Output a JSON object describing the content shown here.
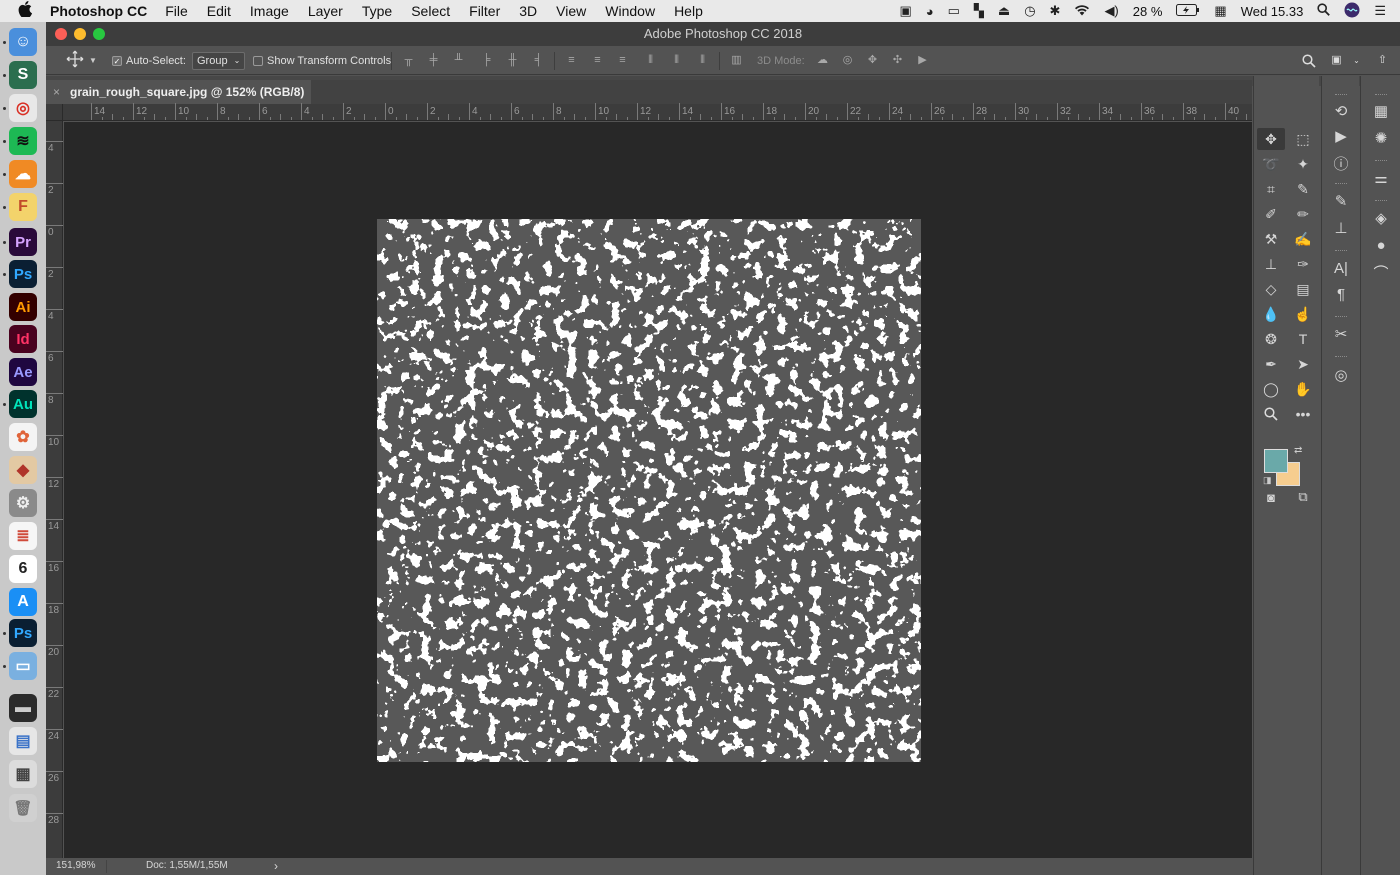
{
  "menubar": {
    "app_name": "Photoshop CC",
    "menus": [
      "File",
      "Edit",
      "Image",
      "Layer",
      "Type",
      "Select",
      "Filter",
      "3D",
      "View",
      "Window",
      "Help"
    ],
    "battery": "28 %",
    "clock": "Wed 15.33"
  },
  "window": {
    "title": "Adobe Photoshop CC 2018"
  },
  "options": {
    "auto_select_label": "Auto-Select:",
    "auto_select_value": "Group",
    "show_transform_label": "Show Transform Controls",
    "mode_3d_label": "3D Mode:"
  },
  "document": {
    "tab_title": "grain_rough_square.jpg @ 152% (RGB/8) *",
    "close_glyph": "×"
  },
  "ruler": {
    "h_labels": [
      "14",
      "12",
      "10",
      "8",
      "6",
      "4",
      "2",
      "0",
      "2",
      "4",
      "6",
      "8",
      "10",
      "12",
      "14",
      "16",
      "18",
      "20",
      "22",
      "24",
      "26",
      "28",
      "30",
      "32",
      "34",
      "36",
      "38",
      "40"
    ],
    "v_labels": [
      "4",
      "2",
      "0",
      "2",
      "4",
      "6",
      "8",
      "10",
      "12",
      "14",
      "16",
      "18",
      "20",
      "22",
      "24",
      "26",
      "28"
    ]
  },
  "status": {
    "zoom": "151,98%",
    "doc_size": "Doc: 1,55M/1,55M",
    "arrow": "›"
  },
  "colors": {
    "foreground": "#6aa9a9",
    "background": "#f6cd8f"
  },
  "dock": {
    "apps": [
      {
        "name": "finder",
        "glyph": "☺",
        "bg": "#4a8fdc",
        "fg": "#ffffff"
      },
      {
        "name": "scrivener",
        "glyph": "S",
        "bg": "#2b6e4f",
        "fg": "#ffffff"
      },
      {
        "name": "chrome",
        "glyph": "◎",
        "bg": "#e8e8e8",
        "fg": "#d93025"
      },
      {
        "name": "spotify",
        "glyph": "≋",
        "bg": "#1db954",
        "fg": "#111111"
      },
      {
        "name": "cloud-app",
        "glyph": "☁",
        "bg": "#f08a24",
        "fg": "#ffffff"
      },
      {
        "name": "fontself",
        "glyph": "F",
        "bg": "#f3d36b",
        "fg": "#c24b2a"
      },
      {
        "name": "premiere",
        "glyph": "Pr",
        "bg": "#2a0a3a",
        "fg": "#d6a3ff"
      },
      {
        "name": "photoshop",
        "glyph": "Ps",
        "bg": "#0a1f33",
        "fg": "#31a8ff"
      },
      {
        "name": "illustrator",
        "glyph": "Ai",
        "bg": "#330000",
        "fg": "#ff9a00"
      },
      {
        "name": "indesign",
        "glyph": "Id",
        "bg": "#49021f",
        "fg": "#ff3366"
      },
      {
        "name": "after-effects",
        "glyph": "Ae",
        "bg": "#1f0740",
        "fg": "#9999ff"
      },
      {
        "name": "audition",
        "glyph": "Au",
        "bg": "#00322d",
        "fg": "#00e4bb"
      },
      {
        "name": "photos",
        "glyph": "✿",
        "bg": "#f4f4f4",
        "fg": "#e0643a"
      },
      {
        "name": "ruby-app",
        "glyph": "◆",
        "bg": "#e3c9a3",
        "fg": "#b0342a"
      },
      {
        "name": "system-preferences",
        "glyph": "⚙",
        "bg": "#8a8a8a",
        "fg": "#eeeeee"
      },
      {
        "name": "notes",
        "glyph": "≣",
        "bg": "#f6f6f6",
        "fg": "#d04a3a"
      },
      {
        "name": "calendar",
        "glyph": "6",
        "bg": "#ffffff",
        "fg": "#222222"
      },
      {
        "name": "app-store",
        "glyph": "A",
        "bg": "#1a8ff5",
        "fg": "#ffffff"
      },
      {
        "name": "photoshop-2",
        "glyph": "Ps",
        "bg": "#0a1f33",
        "fg": "#31a8ff"
      },
      {
        "name": "preview",
        "glyph": "▭",
        "bg": "#7ab0e0",
        "fg": "#ffffff"
      },
      {
        "name": "terminal-window",
        "glyph": "▬",
        "bg": "#2b2b2b",
        "fg": "#cccccc"
      },
      {
        "name": "doc-window",
        "glyph": "▤",
        "bg": "#e6e6e6",
        "fg": "#3b73c8"
      },
      {
        "name": "screenshot-window",
        "glyph": "▦",
        "bg": "#dcdcdc",
        "fg": "#444444"
      },
      {
        "name": "trash",
        "glyph": "🗑",
        "bg": "#d0d0d0",
        "fg": "#777777"
      }
    ]
  }
}
